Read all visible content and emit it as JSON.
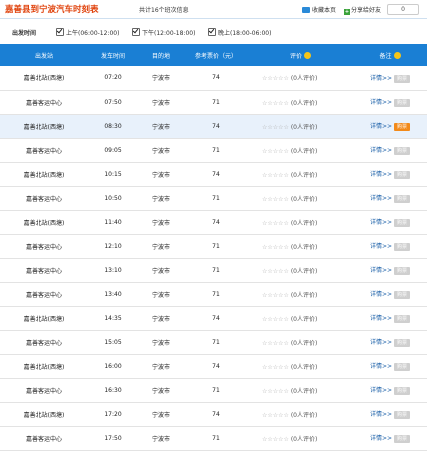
{
  "header": {
    "title": "嘉善县到宁波汽车时刻表",
    "subtitle": "共计16个班次信息",
    "fav_label": "收藏本页",
    "share_label": "分享给好友",
    "share_count": "0"
  },
  "filter": {
    "label": "出发时间",
    "options": [
      {
        "label": "上午(06:00-12:00)",
        "checked": true
      },
      {
        "label": "下午(12:00-18:00)",
        "checked": true
      },
      {
        "label": "晚上(18:00-06:00)",
        "checked": true
      }
    ]
  },
  "table": {
    "headers": [
      "出发站",
      "发车时间",
      "目的地",
      "参考票价（元）",
      "评价",
      "备注"
    ],
    "rows": [
      {
        "station": "嘉善北站(西塘)",
        "time": "07:20",
        "dest": "宁波市",
        "price": "74",
        "rating": "(0人评价)",
        "detail": "详情>>",
        "buy": "购票",
        "buy_active": false
      },
      {
        "station": "嘉善客运中心",
        "time": "07:50",
        "dest": "宁波市",
        "price": "71",
        "rating": "(0人评价)",
        "detail": "详情>>",
        "buy": "购票",
        "buy_active": false
      },
      {
        "station": "嘉善北站(西塘)",
        "time": "08:30",
        "dest": "宁波市",
        "price": "74",
        "rating": "(0人评价)",
        "detail": "详情>>",
        "buy": "购票",
        "buy_active": true
      },
      {
        "station": "嘉善客运中心",
        "time": "09:05",
        "dest": "宁波市",
        "price": "71",
        "rating": "(0人评价)",
        "detail": "详情>>",
        "buy": "购票",
        "buy_active": false
      },
      {
        "station": "嘉善北站(西塘)",
        "time": "10:15",
        "dest": "宁波市",
        "price": "74",
        "rating": "(0人评价)",
        "detail": "详情>>",
        "buy": "购票",
        "buy_active": false
      },
      {
        "station": "嘉善客运中心",
        "time": "10:50",
        "dest": "宁波市",
        "price": "71",
        "rating": "(0人评价)",
        "detail": "详情>>",
        "buy": "购票",
        "buy_active": false
      },
      {
        "station": "嘉善北站(西塘)",
        "time": "11:40",
        "dest": "宁波市",
        "price": "74",
        "rating": "(0人评价)",
        "detail": "详情>>",
        "buy": "购票",
        "buy_active": false
      },
      {
        "station": "嘉善客运中心",
        "time": "12:10",
        "dest": "宁波市",
        "price": "71",
        "rating": "(0人评价)",
        "detail": "详情>>",
        "buy": "购票",
        "buy_active": false
      },
      {
        "station": "嘉善客运中心",
        "time": "13:10",
        "dest": "宁波市",
        "price": "71",
        "rating": "(0人评价)",
        "detail": "详情>>",
        "buy": "购票",
        "buy_active": false
      },
      {
        "station": "嘉善客运中心",
        "time": "13:40",
        "dest": "宁波市",
        "price": "71",
        "rating": "(0人评价)",
        "detail": "详情>>",
        "buy": "购票",
        "buy_active": false
      },
      {
        "station": "嘉善北站(西塘)",
        "time": "14:35",
        "dest": "宁波市",
        "price": "74",
        "rating": "(0人评价)",
        "detail": "详情>>",
        "buy": "购票",
        "buy_active": false
      },
      {
        "station": "嘉善客运中心",
        "time": "15:05",
        "dest": "宁波市",
        "price": "71",
        "rating": "(0人评价)",
        "detail": "详情>>",
        "buy": "购票",
        "buy_active": false
      },
      {
        "station": "嘉善北站(西塘)",
        "time": "16:00",
        "dest": "宁波市",
        "price": "74",
        "rating": "(0人评价)",
        "detail": "详情>>",
        "buy": "购票",
        "buy_active": false
      },
      {
        "station": "嘉善客运中心",
        "time": "16:30",
        "dest": "宁波市",
        "price": "71",
        "rating": "(0人评价)",
        "detail": "详情>>",
        "buy": "购票",
        "buy_active": false
      },
      {
        "station": "嘉善北站(西塘)",
        "time": "17:20",
        "dest": "宁波市",
        "price": "74",
        "rating": "(0人评价)",
        "detail": "详情>>",
        "buy": "购票",
        "buy_active": false
      },
      {
        "station": "嘉善客运中心",
        "time": "17:50",
        "dest": "宁波市",
        "price": "71",
        "rating": "(0人评价)",
        "detail": "详情>>",
        "buy": "购票",
        "buy_active": false
      }
    ]
  },
  "colors": {
    "header_bg": "#1a7fd4",
    "title": "#e0440e",
    "buy_active": "#f28a1a",
    "buy_inactive": "#cfcfcf",
    "highlight_row": "#e8f1fb"
  },
  "icons": {
    "rating_star": "star-icon",
    "smile": "smile-icon",
    "favorite": "folder-icon",
    "share": "share-icon"
  }
}
